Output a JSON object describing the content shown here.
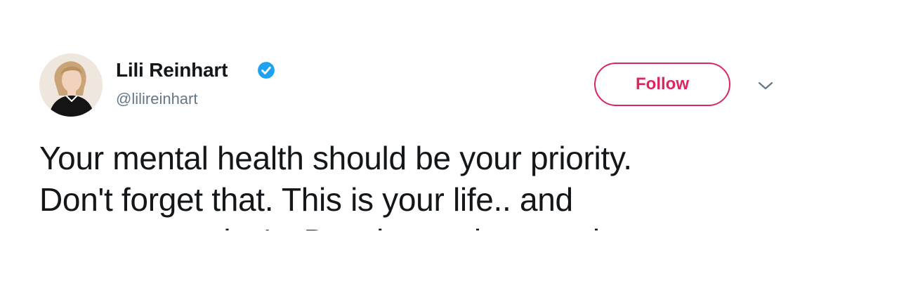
{
  "author": {
    "display_name": "Lili Reinhart",
    "handle": "@lilireinhart",
    "verified": true
  },
  "actions": {
    "follow_label": "Follow",
    "menu_icon": "chevron-down-icon"
  },
  "tweet": {
    "lines": [
      "Your mental health should be your priority.",
      "Don't forget that. This is your life.. and",
      "not anyone else's. Do what makes you happy."
    ]
  },
  "colors": {
    "accent": "#e0245e",
    "verified": "#1da1f2",
    "secondary_text": "#657786",
    "primary_text": "#14171a"
  }
}
